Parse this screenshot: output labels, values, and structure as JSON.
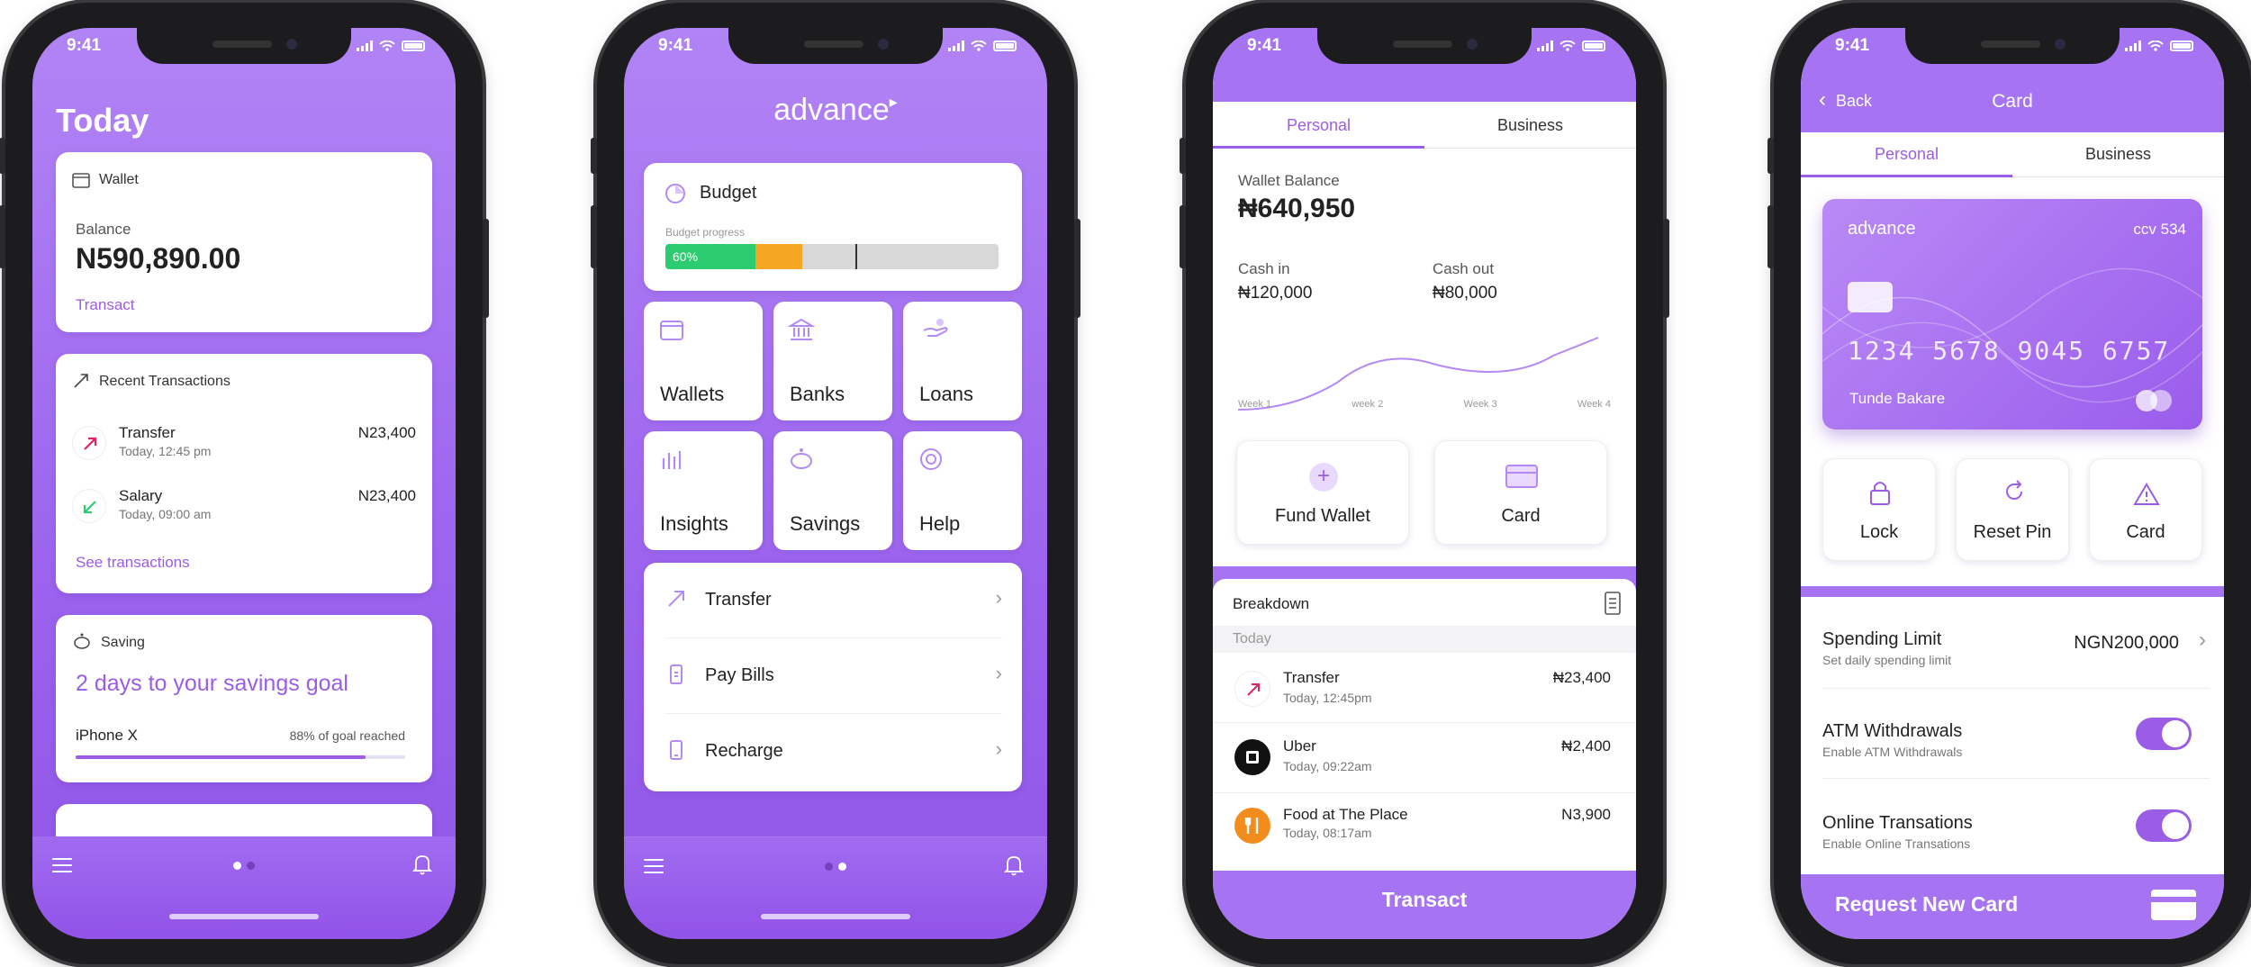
{
  "status": {
    "time": "9:41"
  },
  "phone1": {
    "title": "Today",
    "wallet": {
      "label": "Wallet",
      "balance_label": "Balance",
      "balance": "N590,890.00",
      "action": "Transact"
    },
    "recent": {
      "title": "Recent Transactions",
      "items": [
        {
          "name": "Transfer",
          "time": "Today, 12:45 pm",
          "amount": "N23,400",
          "icon": "arrow-up-right-icon"
        },
        {
          "name": "Salary",
          "time": "Today, 09:00 am",
          "amount": "N23,400",
          "icon": "arrow-down-left-icon"
        }
      ],
      "link": "See transactions"
    },
    "saving": {
      "label": "Saving",
      "headline": "2 days to your savings goal",
      "goal": "iPhone X",
      "progress_text": "88% of goal reached",
      "progress": 0.88
    }
  },
  "phone2": {
    "brand": "advance",
    "budget": {
      "title": "Budget",
      "sub": "Budget progress",
      "percent": "60%",
      "green": 0.27,
      "orange": 0.14,
      "marker": 0.57
    },
    "tiles": [
      "Wallets",
      "Banks",
      "Loans",
      "Insights",
      "Savings",
      "Help"
    ],
    "menu": [
      "Transfer",
      "Pay Bills",
      "Recharge"
    ]
  },
  "phone3": {
    "tabs": [
      "Personal",
      "Business"
    ],
    "wallet_label": "Wallet Balance",
    "wallet_balance": "₦640,950",
    "cash_in_label": "Cash in",
    "cash_in": "₦120,000",
    "cash_out_label": "Cash out",
    "cash_out": "₦80,000",
    "weeks": [
      "Week 1",
      "week 2",
      "Week 3",
      "Week 4"
    ],
    "actions": [
      "Fund Wallet",
      "Card"
    ],
    "breakdown_title": "Breakdown",
    "day": "Today",
    "transactions": [
      {
        "name": "Transfer",
        "time": "Today, 12:45pm",
        "amount": "₦23,400"
      },
      {
        "name": "Uber",
        "time": "Today, 09:22am",
        "amount": "₦2,400"
      },
      {
        "name": "Food at The Place",
        "time": "Today, 08:17am",
        "amount": "N3,900"
      }
    ],
    "cta": "Transact"
  },
  "phone4": {
    "back": "Back",
    "title": "Card",
    "tabs": [
      "Personal",
      "Business"
    ],
    "card": {
      "brand": "advance",
      "ccv": "ccv 534",
      "number": "1234 5678 9045 6757",
      "holder": "Tunde Bakare"
    },
    "actions": [
      "Lock",
      "Reset Pin",
      "Card"
    ],
    "settings": [
      {
        "title": "Spending Limit",
        "sub": "Set daily spending limit",
        "value": "NGN200,000"
      },
      {
        "title": "ATM Withdrawals",
        "sub": "Enable ATM Withdrawals"
      },
      {
        "title": "Online Transations",
        "sub": "Enable Online Transations"
      }
    ],
    "cta": "Request New Card"
  },
  "colors": {
    "accent": "#9b5de5",
    "green": "#2ecc71",
    "orange": "#f5a623",
    "red": "#e0245e"
  }
}
